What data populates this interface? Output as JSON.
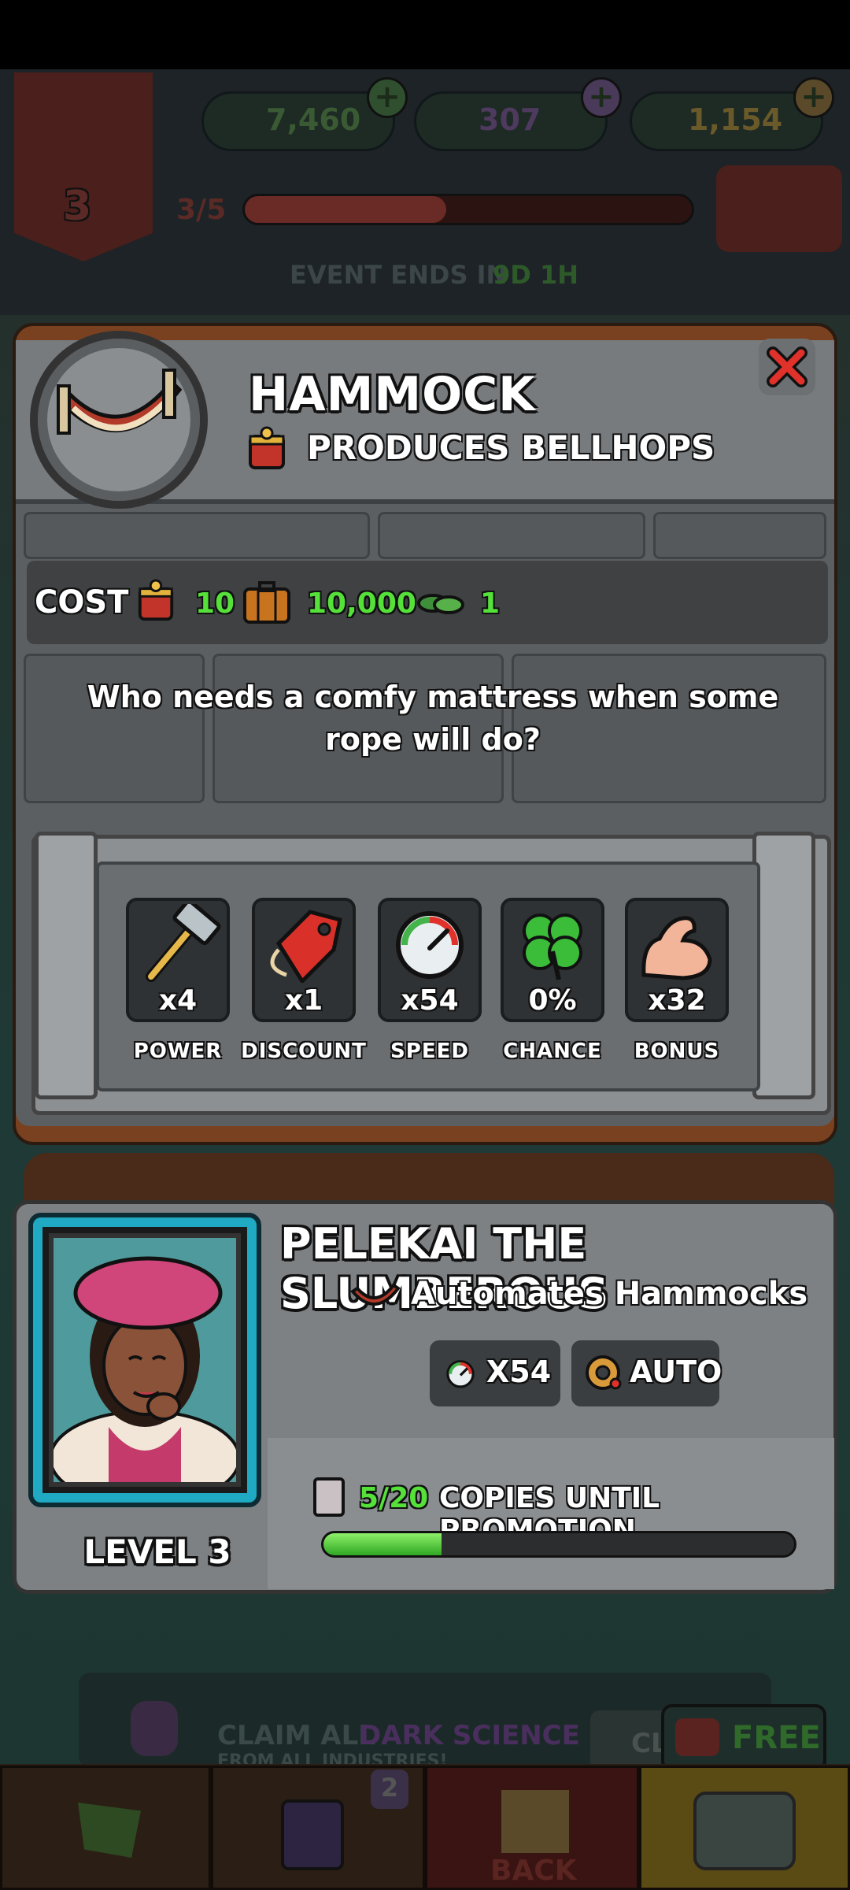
{
  "top_bar": {
    "level": "3",
    "resources": [
      {
        "icon": "cash-icon",
        "value": "7,460"
      },
      {
        "icon": "dark-science-icon",
        "value": "307"
      },
      {
        "icon": "gold-icon",
        "value": "1,154"
      }
    ],
    "progress_text": "3/5",
    "progress_fraction": 0.45,
    "event_label": "EVENT ENDS IN",
    "event_time": "9D 1H"
  },
  "popup": {
    "title": "HAMMOCK",
    "produces": "PRODUCES BELLHOPS",
    "cost_label": "COST",
    "costs": [
      {
        "icon": "bellhop-icon",
        "value": "10"
      },
      {
        "icon": "suitcase-icon",
        "value": "10,000"
      },
      {
        "icon": "cash-icon",
        "value": "1"
      }
    ],
    "description": "Who needs a comfy mattress when some rope will do?",
    "stats": [
      {
        "icon": "hammer-icon",
        "value": "x4",
        "label": "POWER"
      },
      {
        "icon": "price-tag-icon",
        "value": "x1",
        "label": "DISCOUNT"
      },
      {
        "icon": "speedometer-icon",
        "value": "x54",
        "label": "SPEED"
      },
      {
        "icon": "clover-icon",
        "value": "0%",
        "label": "CHANCE"
      },
      {
        "icon": "flexed-arm-icon",
        "value": "x32",
        "label": "BONUS"
      }
    ]
  },
  "character": {
    "name": "PELEKAI THE SLUMBEROUS",
    "automates": "Automates Hammocks",
    "speed_chip": "X54",
    "auto_chip": "AUTO",
    "level": "LEVEL 3",
    "copies_count": "5/20",
    "copies_text": "COPIES UNTIL PROMOTION",
    "copies_fraction": 0.25
  },
  "background_banner": {
    "claim_text_1": "CLAIM ALL",
    "claim_text_2": "DARK SCIENCE",
    "claim_text_3": "FROM ALL INDUSTRIES!",
    "free_label": "FREE",
    "partial_button": "CL"
  },
  "bottom_nav": {
    "cards_badge": "2",
    "back_label": "BACK"
  },
  "colors": {
    "accent_green": "#55e03a",
    "frame_cyan": "#1fa9c2",
    "close_red": "#e0322a",
    "wood": "#7a4121"
  }
}
